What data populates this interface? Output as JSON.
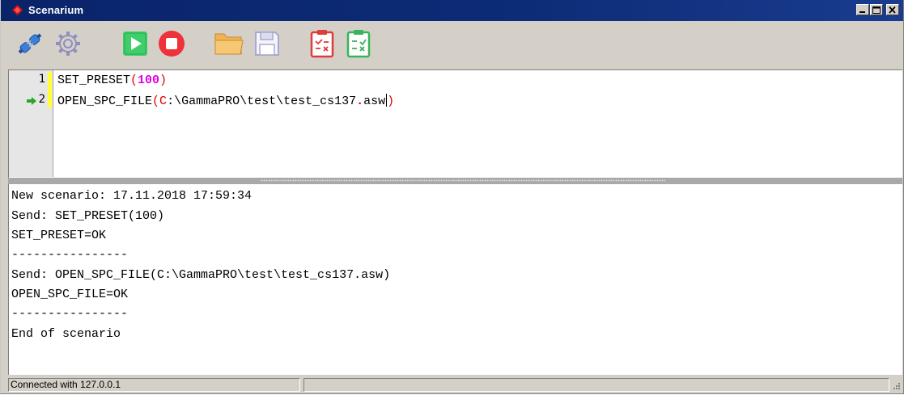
{
  "window": {
    "title": "Scenarium"
  },
  "toolbar": {
    "buttons": [
      {
        "name": "connect",
        "icon": "plug-connector-icon"
      },
      {
        "name": "settings",
        "icon": "gear-icon"
      },
      {
        "name": "run",
        "icon": "play-icon"
      },
      {
        "name": "stop",
        "icon": "stop-icon"
      },
      {
        "name": "open",
        "icon": "folder-icon"
      },
      {
        "name": "save",
        "icon": "floppy-disk-icon"
      },
      {
        "name": "checklist-red",
        "icon": "clipboard-red-icon"
      },
      {
        "name": "checklist-green",
        "icon": "clipboard-green-icon"
      }
    ]
  },
  "editor": {
    "lines": [
      {
        "number": "1",
        "command": "SET_PRESET",
        "open": "(",
        "arg": "100",
        "close": ")"
      },
      {
        "number": "2",
        "command": "OPEN_SPC_FILE",
        "open": "(",
        "arg_prefix": "C",
        "arg_mid": ":\\GammaPRO\\test\\test_cs137",
        "arg_dot": ".",
        "arg_ext": "asw",
        "close": ")"
      }
    ],
    "current_line": 2
  },
  "log": {
    "lines": [
      "New scenario: 17.11.2018 17:59:34",
      "Send: SET_PRESET(100)",
      "SET_PRESET=OK",
      "----------------",
      "Send: OPEN_SPC_FILE(C:\\GammaPRO\\test\\test_cs137.asw)",
      "OPEN_SPC_FILE=OK",
      "----------------",
      "End of scenario"
    ]
  },
  "statusbar": {
    "connection": "Connected with 127.0.0.1",
    "secondary": ""
  },
  "colors": {
    "titlebar": "#0a246a",
    "keyword_number": "#e000e0",
    "string": "#e00000",
    "change_marker": "#ffff33",
    "current_line_arrow": "#22aa22"
  }
}
